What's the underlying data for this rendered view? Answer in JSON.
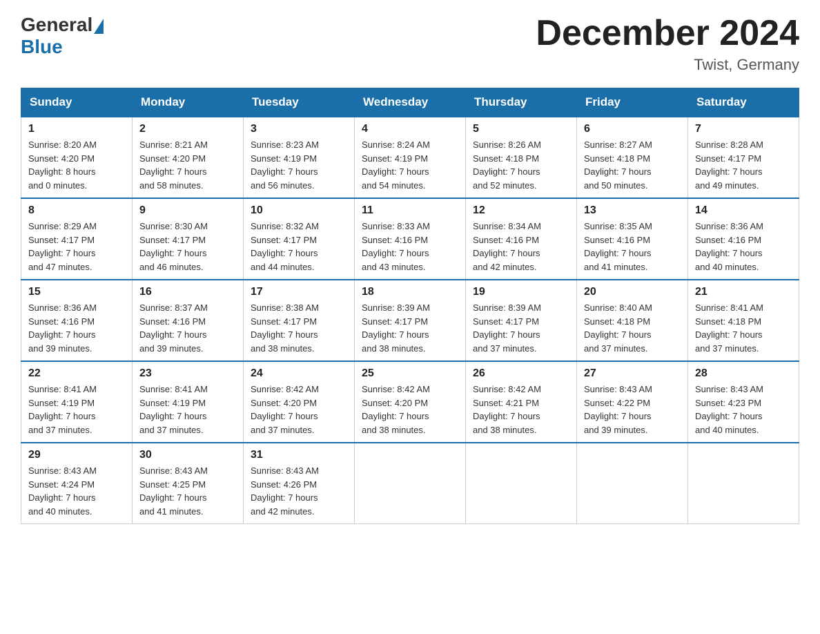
{
  "header": {
    "logo_general": "General",
    "logo_blue": "Blue",
    "month_title": "December 2024",
    "location": "Twist, Germany"
  },
  "days_of_week": [
    "Sunday",
    "Monday",
    "Tuesday",
    "Wednesday",
    "Thursday",
    "Friday",
    "Saturday"
  ],
  "weeks": [
    [
      {
        "day": "1",
        "info": "Sunrise: 8:20 AM\nSunset: 4:20 PM\nDaylight: 8 hours\nand 0 minutes."
      },
      {
        "day": "2",
        "info": "Sunrise: 8:21 AM\nSunset: 4:20 PM\nDaylight: 7 hours\nand 58 minutes."
      },
      {
        "day": "3",
        "info": "Sunrise: 8:23 AM\nSunset: 4:19 PM\nDaylight: 7 hours\nand 56 minutes."
      },
      {
        "day": "4",
        "info": "Sunrise: 8:24 AM\nSunset: 4:19 PM\nDaylight: 7 hours\nand 54 minutes."
      },
      {
        "day": "5",
        "info": "Sunrise: 8:26 AM\nSunset: 4:18 PM\nDaylight: 7 hours\nand 52 minutes."
      },
      {
        "day": "6",
        "info": "Sunrise: 8:27 AM\nSunset: 4:18 PM\nDaylight: 7 hours\nand 50 minutes."
      },
      {
        "day": "7",
        "info": "Sunrise: 8:28 AM\nSunset: 4:17 PM\nDaylight: 7 hours\nand 49 minutes."
      }
    ],
    [
      {
        "day": "8",
        "info": "Sunrise: 8:29 AM\nSunset: 4:17 PM\nDaylight: 7 hours\nand 47 minutes."
      },
      {
        "day": "9",
        "info": "Sunrise: 8:30 AM\nSunset: 4:17 PM\nDaylight: 7 hours\nand 46 minutes."
      },
      {
        "day": "10",
        "info": "Sunrise: 8:32 AM\nSunset: 4:17 PM\nDaylight: 7 hours\nand 44 minutes."
      },
      {
        "day": "11",
        "info": "Sunrise: 8:33 AM\nSunset: 4:16 PM\nDaylight: 7 hours\nand 43 minutes."
      },
      {
        "day": "12",
        "info": "Sunrise: 8:34 AM\nSunset: 4:16 PM\nDaylight: 7 hours\nand 42 minutes."
      },
      {
        "day": "13",
        "info": "Sunrise: 8:35 AM\nSunset: 4:16 PM\nDaylight: 7 hours\nand 41 minutes."
      },
      {
        "day": "14",
        "info": "Sunrise: 8:36 AM\nSunset: 4:16 PM\nDaylight: 7 hours\nand 40 minutes."
      }
    ],
    [
      {
        "day": "15",
        "info": "Sunrise: 8:36 AM\nSunset: 4:16 PM\nDaylight: 7 hours\nand 39 minutes."
      },
      {
        "day": "16",
        "info": "Sunrise: 8:37 AM\nSunset: 4:16 PM\nDaylight: 7 hours\nand 39 minutes."
      },
      {
        "day": "17",
        "info": "Sunrise: 8:38 AM\nSunset: 4:17 PM\nDaylight: 7 hours\nand 38 minutes."
      },
      {
        "day": "18",
        "info": "Sunrise: 8:39 AM\nSunset: 4:17 PM\nDaylight: 7 hours\nand 38 minutes."
      },
      {
        "day": "19",
        "info": "Sunrise: 8:39 AM\nSunset: 4:17 PM\nDaylight: 7 hours\nand 37 minutes."
      },
      {
        "day": "20",
        "info": "Sunrise: 8:40 AM\nSunset: 4:18 PM\nDaylight: 7 hours\nand 37 minutes."
      },
      {
        "day": "21",
        "info": "Sunrise: 8:41 AM\nSunset: 4:18 PM\nDaylight: 7 hours\nand 37 minutes."
      }
    ],
    [
      {
        "day": "22",
        "info": "Sunrise: 8:41 AM\nSunset: 4:19 PM\nDaylight: 7 hours\nand 37 minutes."
      },
      {
        "day": "23",
        "info": "Sunrise: 8:41 AM\nSunset: 4:19 PM\nDaylight: 7 hours\nand 37 minutes."
      },
      {
        "day": "24",
        "info": "Sunrise: 8:42 AM\nSunset: 4:20 PM\nDaylight: 7 hours\nand 37 minutes."
      },
      {
        "day": "25",
        "info": "Sunrise: 8:42 AM\nSunset: 4:20 PM\nDaylight: 7 hours\nand 38 minutes."
      },
      {
        "day": "26",
        "info": "Sunrise: 8:42 AM\nSunset: 4:21 PM\nDaylight: 7 hours\nand 38 minutes."
      },
      {
        "day": "27",
        "info": "Sunrise: 8:43 AM\nSunset: 4:22 PM\nDaylight: 7 hours\nand 39 minutes."
      },
      {
        "day": "28",
        "info": "Sunrise: 8:43 AM\nSunset: 4:23 PM\nDaylight: 7 hours\nand 40 minutes."
      }
    ],
    [
      {
        "day": "29",
        "info": "Sunrise: 8:43 AM\nSunset: 4:24 PM\nDaylight: 7 hours\nand 40 minutes."
      },
      {
        "day": "30",
        "info": "Sunrise: 8:43 AM\nSunset: 4:25 PM\nDaylight: 7 hours\nand 41 minutes."
      },
      {
        "day": "31",
        "info": "Sunrise: 8:43 AM\nSunset: 4:26 PM\nDaylight: 7 hours\nand 42 minutes."
      },
      null,
      null,
      null,
      null
    ]
  ]
}
